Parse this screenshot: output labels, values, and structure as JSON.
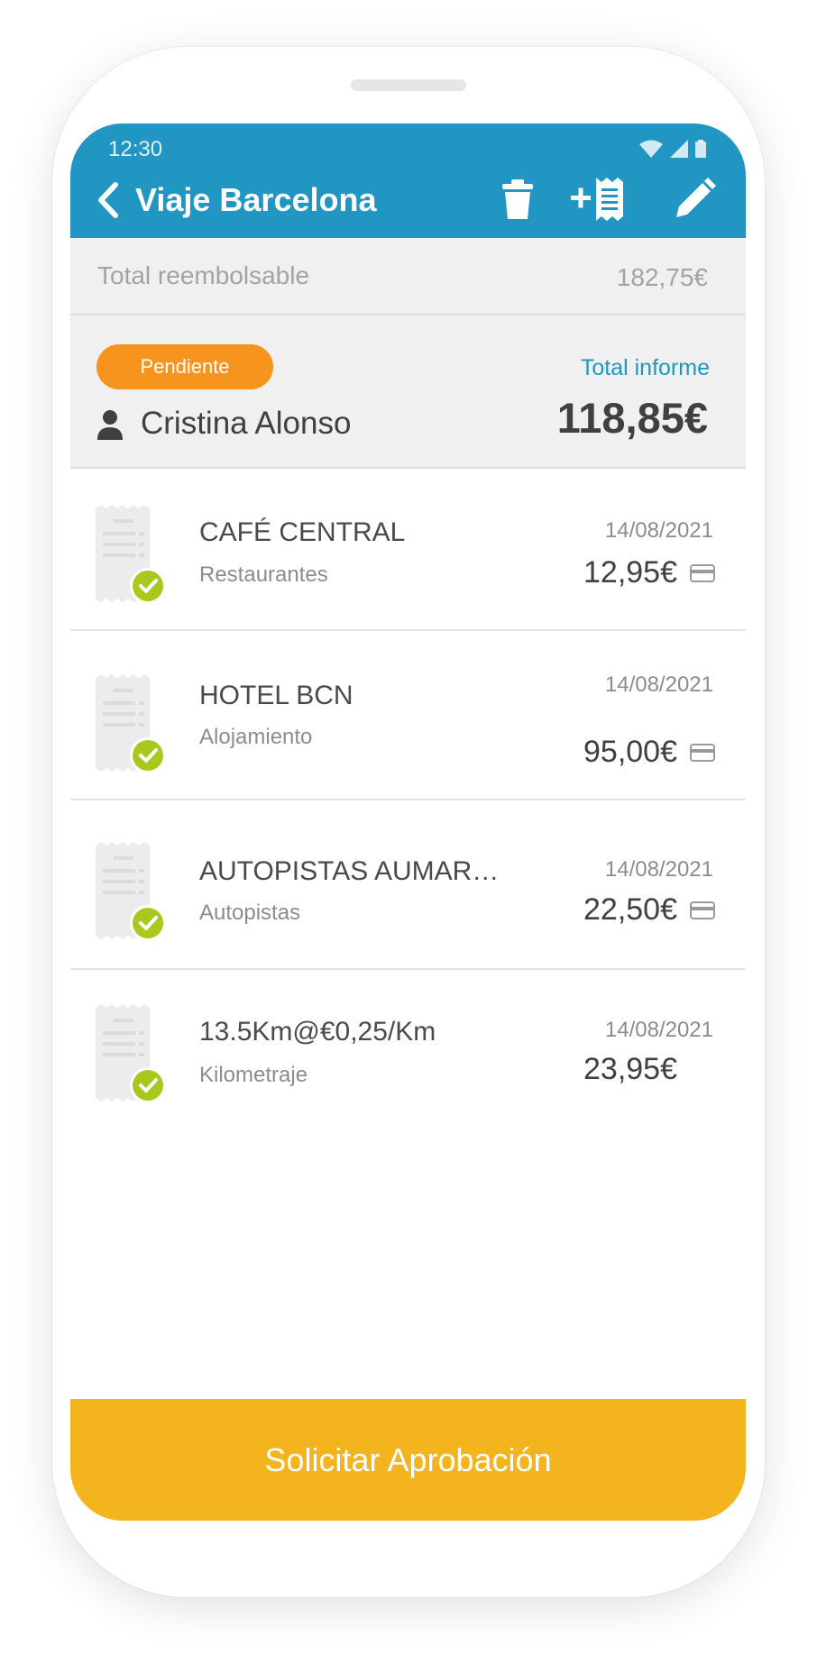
{
  "status_bar": {
    "time": "12:30"
  },
  "header": {
    "title": "Viaje Barcelona",
    "icons": [
      "back-icon",
      "trash-icon",
      "add-receipt-icon",
      "edit-icon"
    ]
  },
  "reimbursable": {
    "label": "Total reembolsable",
    "value": "182,75€"
  },
  "summary": {
    "status": "Pendiente",
    "person": "Cristina Alonso",
    "total_label": "Total informe",
    "total_value": "118,85€"
  },
  "expenses": [
    {
      "merchant": "CAFÉ CENTRAL",
      "category": "Restaurantes",
      "date": "14/08/2021",
      "amount": "12,95€",
      "card": true
    },
    {
      "merchant": "HOTEL BCN",
      "category": "Alojamiento",
      "date": "14/08/2021",
      "amount": "95,00€",
      "card": true
    },
    {
      "merchant": "AUTOPISTAS AUMAR…",
      "category": "Autopistas",
      "date": "14/08/2021",
      "amount": "22,50€",
      "card": true
    },
    {
      "merchant": "13.5Km@€0,25/Km",
      "category": "Kilometraje",
      "date": "14/08/2021",
      "amount": "23,95€",
      "card": false
    }
  ],
  "footer": {
    "button_label": "Solicitar Aprobación"
  },
  "colors": {
    "header": "#2196c2",
    "badge": "#f7941d",
    "button": "#f4b41e",
    "check": "#a9c81e"
  }
}
